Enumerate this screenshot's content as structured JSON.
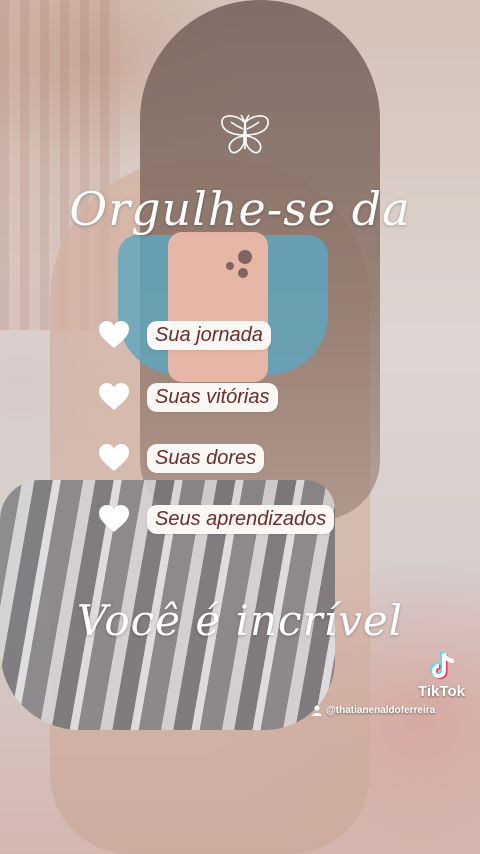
{
  "headline": "Orgulhe-se da",
  "items": [
    {
      "label": "Sua jornada"
    },
    {
      "label": "Suas vitórias"
    },
    {
      "label": "Suas dores"
    },
    {
      "label": "Seus aprendizados"
    }
  ],
  "closing": "Você é incrível",
  "watermark": {
    "brand": "TikTok",
    "handle": "@thatianenaldoferreira"
  },
  "icons": {
    "butterfly": "butterfly-icon",
    "heart": "heart-icon",
    "tiktok": "tiktok-logo-icon",
    "user": "user-icon"
  },
  "colors": {
    "pill_background": "#fbf7f5",
    "pill_text": "#6b2c2a",
    "overlay_text": "#ffffff"
  }
}
